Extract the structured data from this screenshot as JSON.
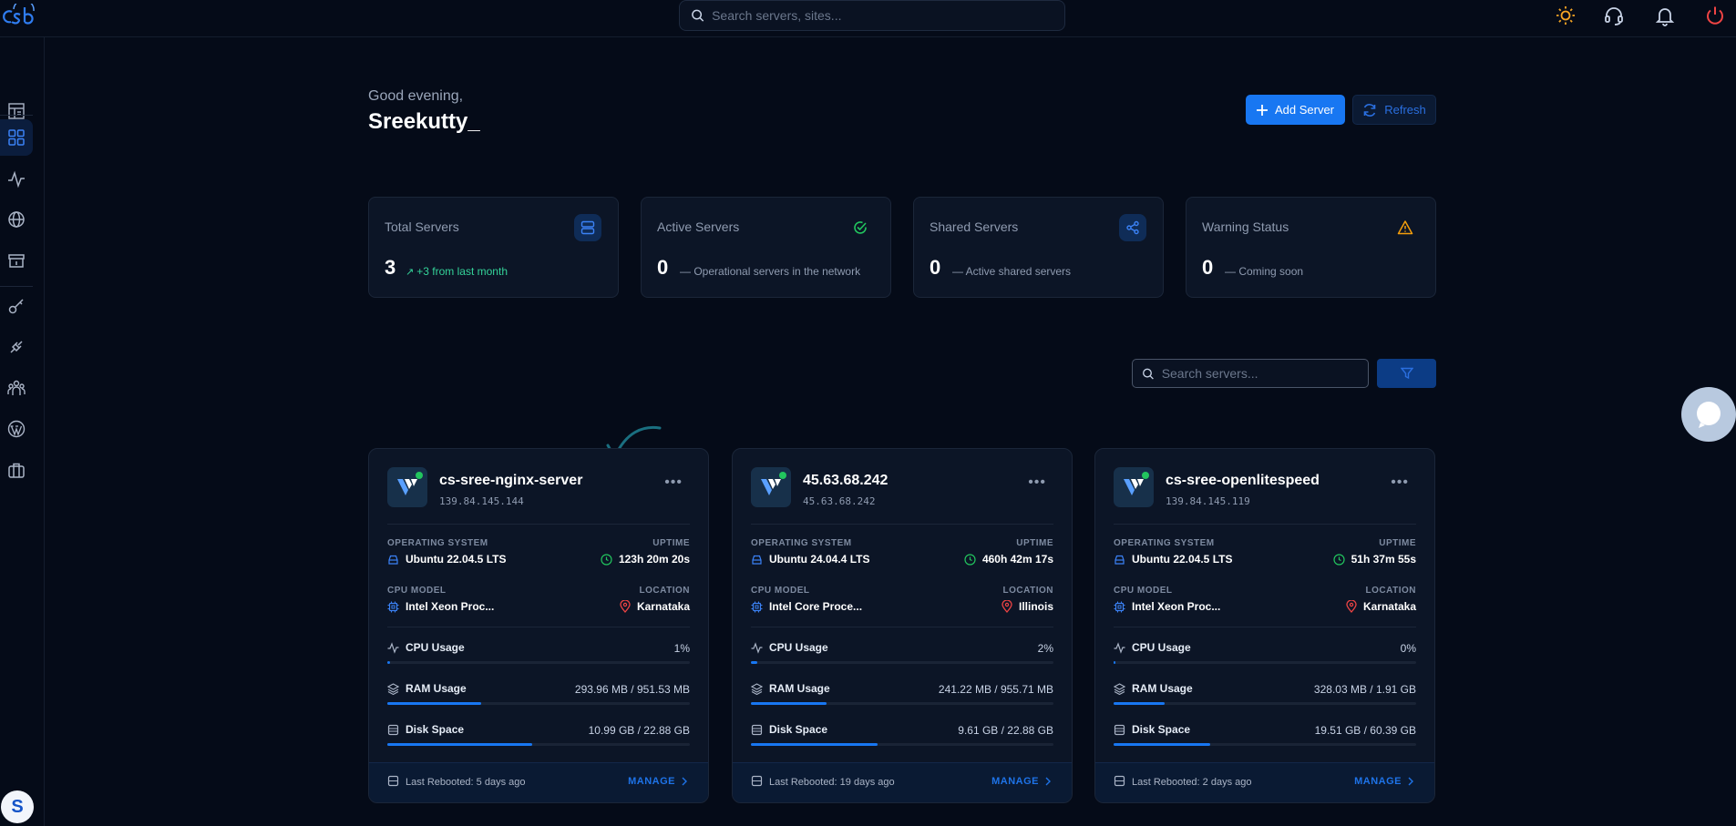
{
  "app": {
    "brand": "cSb"
  },
  "topbar": {
    "search_placeholder": "Search servers, sites..."
  },
  "colors": {
    "accent": "#1877f2",
    "success": "#22c55e",
    "warning": "#f59e0b",
    "danger": "#ef4444",
    "background": "#050b18"
  },
  "sidebar": {
    "items": [
      {
        "icon": "dashboard-layout-icon"
      },
      {
        "icon": "grid-icon",
        "active": true
      },
      {
        "icon": "activity-icon"
      },
      {
        "icon": "globe-icon"
      },
      {
        "icon": "store-icon"
      },
      {
        "icon": "key-icon"
      },
      {
        "icon": "plug-icon"
      },
      {
        "icon": "team-icon"
      },
      {
        "icon": "wordpress-icon"
      },
      {
        "icon": "briefcase-icon"
      }
    ],
    "avatar_initial": "S"
  },
  "header": {
    "greeting": "Good evening,",
    "username": "Sreekutty_",
    "add_server_label": "Add Server",
    "refresh_label": "Refresh"
  },
  "stats": [
    {
      "title": "Total Servers",
      "value": "3",
      "sub": "+3 from last month",
      "icon": "server-stack-icon"
    },
    {
      "title": "Active Servers",
      "value": "0",
      "sub": "Operational servers in the network",
      "icon": "check-circle-icon"
    },
    {
      "title": "Shared Servers",
      "value": "0",
      "sub": "Active shared servers",
      "icon": "share-icon"
    },
    {
      "title": "Warning Status",
      "value": "0",
      "sub": "Coming soon",
      "icon": "warning-icon"
    }
  ],
  "server_search": {
    "placeholder": "Search servers..."
  },
  "labels": {
    "os": "OPERATING SYSTEM",
    "uptime": "UPTIME",
    "cpu_model": "CPU MODEL",
    "location": "LOCATION",
    "cpu_usage": "CPU Usage",
    "ram_usage": "RAM Usage",
    "disk_space": "Disk Space",
    "manage": "MANAGE"
  },
  "servers": [
    {
      "name": "cs-sree-nginx-server",
      "ip": "139.84.145.144",
      "os": "Ubuntu 22.04.5 LTS",
      "uptime": "123h 20m 20s",
      "cpu_model": "Intel Xeon Proc...",
      "location": "Karnataka",
      "cpu": "1%",
      "cpu_pct": 1,
      "ram": "293.96 MB / 951.53 MB",
      "ram_pct": 31,
      "disk": "10.99 GB / 22.88 GB",
      "disk_pct": 48,
      "last_rebooted": "Last Rebooted: 5 days ago"
    },
    {
      "name": "45.63.68.242",
      "ip": "45.63.68.242",
      "os": "Ubuntu 24.04.4 LTS",
      "uptime": "460h 42m 17s",
      "cpu_model": "Intel Core Proce...",
      "location": "Illinois",
      "cpu": "2%",
      "cpu_pct": 2,
      "ram": "241.22 MB / 955.71 MB",
      "ram_pct": 25,
      "disk": "9.61 GB / 22.88 GB",
      "disk_pct": 42,
      "last_rebooted": "Last Rebooted: 19 days ago"
    },
    {
      "name": "cs-sree-openlitespeed",
      "ip": "139.84.145.119",
      "os": "Ubuntu 22.04.5 LTS",
      "uptime": "51h 37m 55s",
      "cpu_model": "Intel Xeon Proc...",
      "location": "Karnataka",
      "cpu": "0%",
      "cpu_pct": 0,
      "ram": "328.03 MB / 1.91 GB",
      "ram_pct": 17,
      "disk": "19.51 GB / 60.39 GB",
      "disk_pct": 32,
      "last_rebooted": "Last Rebooted: 2 days ago"
    }
  ]
}
